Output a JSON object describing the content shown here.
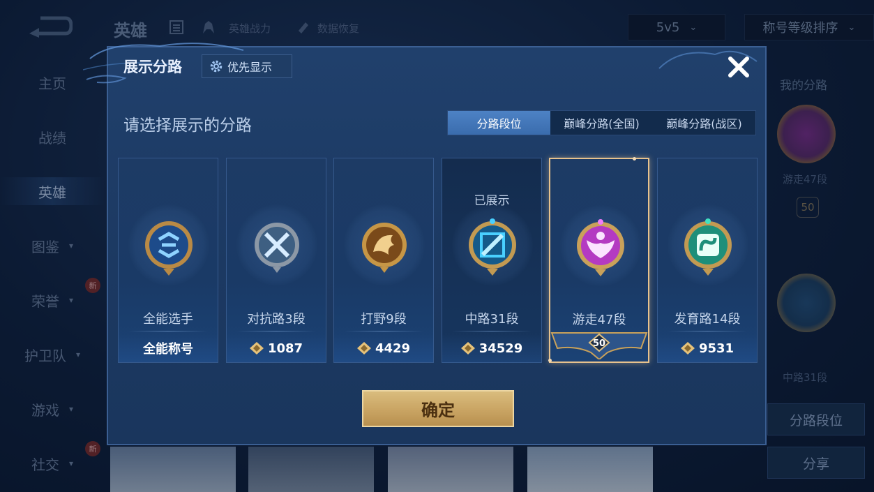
{
  "background": {
    "page_title": "英雄",
    "top_links": [
      "英雄战力",
      "数据恢复"
    ],
    "mode_dropdown": "5v5",
    "sort_dropdown": "称号等级排序",
    "sidebar": [
      {
        "label": "主页"
      },
      {
        "label": "战绩"
      },
      {
        "label": "英雄"
      },
      {
        "label": "图鉴"
      },
      {
        "label": "荣誉",
        "badge": "新"
      },
      {
        "label": "护卫队"
      },
      {
        "label": "游戏"
      },
      {
        "label": "社交",
        "badge": "新"
      }
    ],
    "right_panel": {
      "title": "我的分路",
      "lane1_label": "游走47段",
      "lane1_level": "50",
      "lane2_label": "中路31段",
      "lane_rank_button": "分路段位",
      "share_button": "分享"
    }
  },
  "modal": {
    "title": "展示分路",
    "priority_button": "优先显示",
    "subtitle": "请选择展示的分路",
    "tabs": [
      {
        "label": "分路段位",
        "active": true
      },
      {
        "label": "巅峰分路(全国)",
        "active": false
      },
      {
        "label": "巅峰分路(战区)",
        "active": false
      }
    ],
    "cards": [
      {
        "name": "全能选手",
        "bottom": "全能称号",
        "type": "title",
        "color": "#6fb6ff",
        "emblem": "all-round-emblem-icon"
      },
      {
        "name": "对抗路3段",
        "bottom": "1087",
        "type": "score",
        "color": "#9cc7e8",
        "emblem": "clash-lane-emblem-icon"
      },
      {
        "name": "打野9段",
        "bottom": "4429",
        "type": "score",
        "color": "#c9892e",
        "emblem": "jungle-emblem-icon"
      },
      {
        "name": "中路31段",
        "bottom": "34529",
        "type": "score",
        "color": "#3ec3ff",
        "emblem": "mid-lane-emblem-icon",
        "status": "已展示"
      },
      {
        "name": "游走47段",
        "bottom": "50",
        "type": "level",
        "color": "#d84fe0",
        "emblem": "roam-emblem-icon",
        "selected": true
      },
      {
        "name": "发育路14段",
        "bottom": "9531",
        "type": "score",
        "color": "#2fd3b0",
        "emblem": "farm-lane-emblem-icon"
      }
    ],
    "confirm_button": "确定"
  },
  "colors": {
    "accent_blue": "#3a6cad",
    "gold": "#c9a463",
    "selected_border": "#e7c28d"
  }
}
